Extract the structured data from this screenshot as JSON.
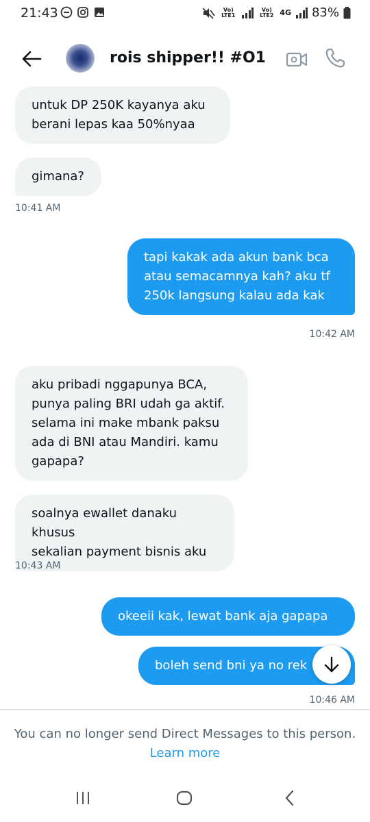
{
  "status_bar": {
    "time": "21:43",
    "battery": "83%",
    "sim1_label": "Vo) LTE1",
    "sim2_label": "Vo) LTE2",
    "network": "4G",
    "left_icons": [
      "do-not-disturb-icon",
      "instagram-icon",
      "gallery-icon"
    ],
    "right_icons": [
      "mute-icon",
      "signal-icon",
      "signal-icon",
      "battery-icon"
    ]
  },
  "header": {
    "title": "rois shipper!! #O1",
    "icons": [
      "back-arrow-icon",
      "video-call-icon",
      "phone-call-icon"
    ]
  },
  "messages": [
    {
      "direction": "in",
      "text_lines": [
        "untuk DP 250K kayanya aku",
        "berani lepas kaa 50%nyaa"
      ]
    },
    {
      "direction": "in",
      "text_lines": [
        "gimana?"
      ]
    },
    {
      "direction": "in_timestamp",
      "text": "10:41 AM"
    },
    {
      "direction": "out",
      "text_lines": [
        "tapi kakak ada akun bank bca",
        "atau semacamnya kah? aku tf",
        "250k langsung kalau ada kak"
      ]
    },
    {
      "direction": "out_timestamp",
      "text": "10:42 AM"
    },
    {
      "direction": "in",
      "text_lines": [
        "aku pribadi nggapunya BCA,",
        "punya paling BRI udah ga aktif.",
        "selama ini make mbank paksu",
        "ada di BNI atau Mandiri. kamu",
        "gapapa?"
      ]
    },
    {
      "direction": "in",
      "text_lines": [
        "soalnya ewallet danaku khusus",
        "sekalian payment bisnis aku"
      ]
    },
    {
      "direction": "in_timestamp",
      "text": "10:43 AM"
    },
    {
      "direction": "out",
      "text_lines": [
        "okeeii kak, lewat bank aja gapapa"
      ]
    },
    {
      "direction": "out",
      "text_lines": [
        "boleh send bni ya no rek"
      ]
    },
    {
      "direction": "out_timestamp",
      "text": "10:46 AM"
    }
  ],
  "footer": {
    "notice": "You can no longer send Direct Messages to this person.",
    "learn_more": "Learn more"
  },
  "colors": {
    "accent": "#1d9bf0",
    "incoming_bubble": "#eff3f4",
    "secondary_text": "#536471"
  }
}
